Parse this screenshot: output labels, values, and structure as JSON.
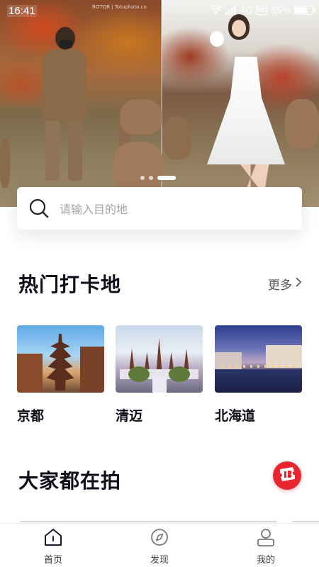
{
  "status_bar": {
    "time": "16:41",
    "network": "4G",
    "hd": "HD",
    "battery_percent": "65%",
    "battery_level": 0.65
  },
  "hero": {
    "photo_credit": "ROTOR | Totophoto.cn",
    "slide_count": 3,
    "active_slide": 2
  },
  "search": {
    "placeholder": "请输入目的地",
    "icon": "search-icon"
  },
  "hot_spots": {
    "title": "热门打卡地",
    "more_label": "更多",
    "items": [
      {
        "label": "京都",
        "image": "kyoto-pagoda-photo"
      },
      {
        "label": "清迈",
        "image": "chiangmai-temple-photo"
      },
      {
        "label": "北海道",
        "image": "hokkaido-canal-photo"
      }
    ]
  },
  "everyone_shooting": {
    "title": "大家都在拍",
    "fab_icon": "ticket-icon",
    "fab_color": "#e8252f"
  },
  "bottom_nav": {
    "items": [
      {
        "label": "首页",
        "icon": "home-icon",
        "active": true
      },
      {
        "label": "发现",
        "icon": "compass-icon",
        "active": false
      },
      {
        "label": "我的",
        "icon": "profile-icon",
        "active": false
      }
    ]
  },
  "colors": {
    "title_text": "#0e0e1a",
    "placeholder_text": "#a4a4a4",
    "accent_red": "#e8252f"
  }
}
